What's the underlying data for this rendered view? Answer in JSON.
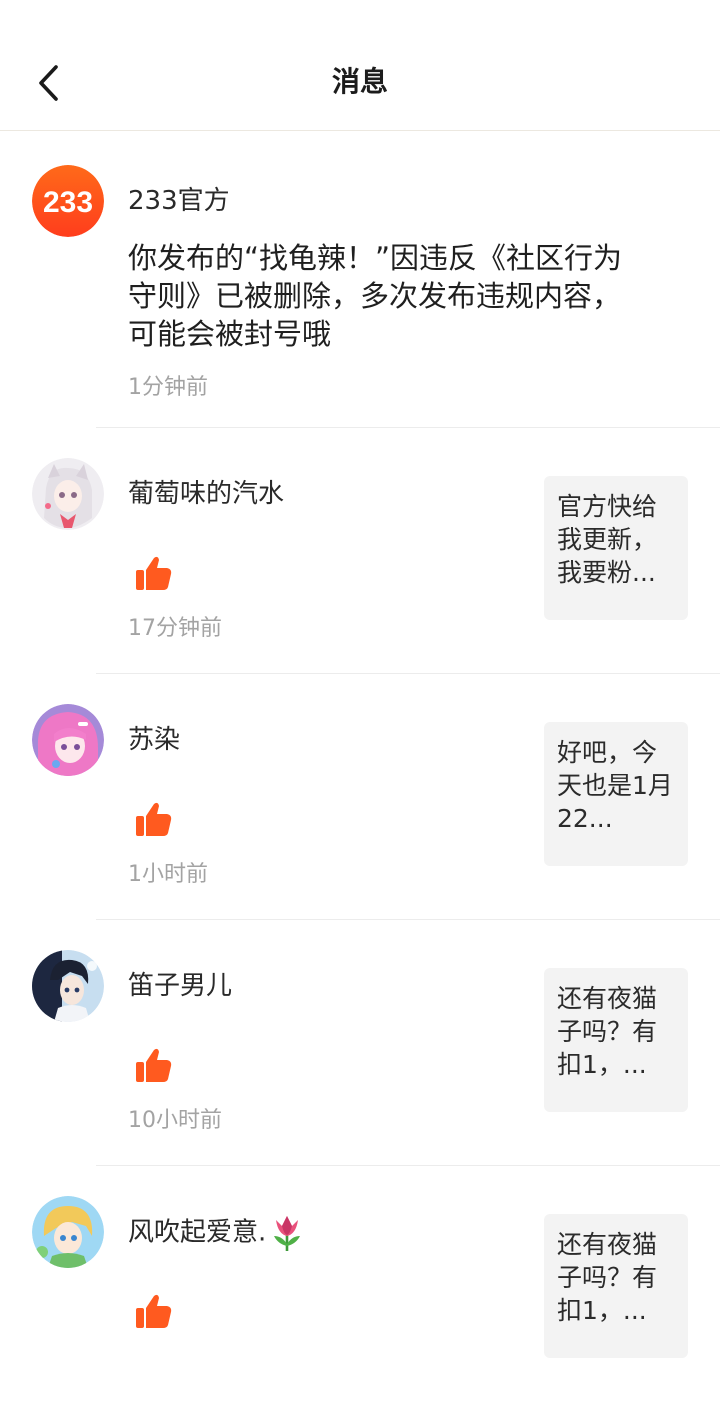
{
  "header": {
    "title": "消息"
  },
  "official": {
    "avatar_text": "233",
    "name": "233官方",
    "content": "你发布的“找龟辣！”因违反《社区行为守则》已被删除，多次发布违规内容，可能会被封号哦",
    "time": "1分钟前"
  },
  "messages": [
    {
      "name": "葡萄味的汽水",
      "time": "17分钟前",
      "preview": "官方快给我更新，我要粉...",
      "avatar_colors": [
        "#e9e6ea",
        "#c9b4c6"
      ]
    },
    {
      "name": "苏染",
      "time": "1小时前",
      "preview": "好吧，今天也是1月22...",
      "avatar_colors": [
        "#e680c8",
        "#8a7ad0"
      ]
    },
    {
      "name": "笛子男儿",
      "time": "10小时前",
      "preview": "还有夜猫子吗？有扣1，...",
      "avatar_colors": [
        "#2a3550",
        "#9ec6e8"
      ]
    },
    {
      "name": "风吹起爱意.",
      "time": "",
      "preview": "还有夜猫子吗？有扣1，...",
      "avatar_colors": [
        "#8fd0f0",
        "#f0c860"
      ]
    }
  ],
  "colors": {
    "accent": "#ff5a1f",
    "time": "#a3a3a3",
    "preview_bg": "#f3f3f3"
  },
  "icons": {
    "back": "chevron-left-icon",
    "like": "thumbs-up-icon",
    "tulip": "tulip-emoji"
  }
}
